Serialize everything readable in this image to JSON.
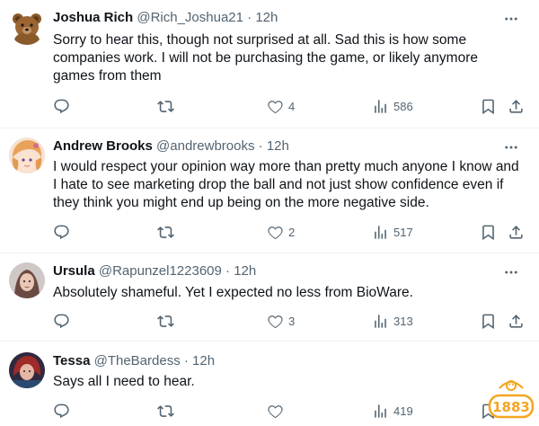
{
  "tweets": [
    {
      "name": "Joshua Rich",
      "handle": "@Rich_Joshua21",
      "dot": "·",
      "time": "12h",
      "lines": [
        "Sorry to hear this, though not surprised at all.  Sad this is how some",
        "companies work.  I will not be purchasing the game, or likely anymore",
        "games from them"
      ],
      "replies": "",
      "retweets": "",
      "likes": "4",
      "views": "586"
    },
    {
      "name": "Andrew Brooks",
      "handle": "@andrewbrooks",
      "dot": "·",
      "time": "12h",
      "lines": [
        "I would respect your opinion way more than pretty much anyone I know and",
        "I hate to see marketing drop the ball and not just show confidence even if",
        "they think you might end up being on the more negative side."
      ],
      "replies": "",
      "retweets": "",
      "likes": "2",
      "views": "517"
    },
    {
      "name": "Ursula",
      "handle": "@Rapunzel1223609",
      "dot": "·",
      "time": "12h",
      "lines": [
        "Absolutely shameful. Yet I expected no less from BioWare."
      ],
      "replies": "",
      "retweets": "",
      "likes": "3",
      "views": "313"
    },
    {
      "name": "Tessa",
      "handle": "@TheBardess",
      "dot": "·",
      "time": "12h",
      "lines": [
        "Says all I need to hear."
      ],
      "replies": "",
      "retweets": "",
      "likes": "",
      "views": "419"
    }
  ],
  "watermark": "1883",
  "colors": {
    "text": "#0f1419",
    "muted": "#536471",
    "divider": "#eff3f4",
    "watermark_orange": "#f5a623"
  },
  "icons": [
    "reply-icon",
    "retweet-icon",
    "like-icon",
    "views-icon",
    "bookmark-icon",
    "share-icon",
    "more-icon"
  ]
}
